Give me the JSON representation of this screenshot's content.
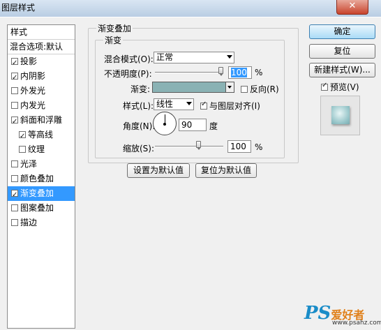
{
  "window": {
    "title": "图层样式",
    "close_symbol": "✕"
  },
  "left_panel": {
    "header": "样式",
    "items": [
      {
        "label": "混合选项:默认",
        "has_checkbox": false,
        "checked": false,
        "selected": false
      },
      {
        "label": "投影",
        "has_checkbox": true,
        "checked": true,
        "selected": false
      },
      {
        "label": "内阴影",
        "has_checkbox": true,
        "checked": true,
        "selected": false
      },
      {
        "label": "外发光",
        "has_checkbox": true,
        "checked": false,
        "selected": false
      },
      {
        "label": "内发光",
        "has_checkbox": true,
        "checked": false,
        "selected": false
      },
      {
        "label": "斜面和浮雕",
        "has_checkbox": true,
        "checked": true,
        "selected": false
      },
      {
        "label": "等高线",
        "has_checkbox": true,
        "checked": true,
        "selected": false,
        "indent": true
      },
      {
        "label": "纹理",
        "has_checkbox": true,
        "checked": false,
        "selected": false,
        "indent": true
      },
      {
        "label": "光泽",
        "has_checkbox": true,
        "checked": false,
        "selected": false
      },
      {
        "label": "颜色叠加",
        "has_checkbox": true,
        "checked": false,
        "selected": false
      },
      {
        "label": "渐变叠加",
        "has_checkbox": true,
        "checked": true,
        "selected": true
      },
      {
        "label": "图案叠加",
        "has_checkbox": true,
        "checked": false,
        "selected": false
      },
      {
        "label": "描边",
        "has_checkbox": true,
        "checked": false,
        "selected": false
      }
    ]
  },
  "panel": {
    "outer_legend": "渐变叠加",
    "inner_legend": "渐变",
    "blend_mode": {
      "label": "混合模式(O):",
      "value": "正常"
    },
    "opacity": {
      "label": "不透明度(P):",
      "value": "100",
      "unit": "%",
      "level_percent": 100
    },
    "gradient": {
      "label": "渐变:",
      "color": "#8ab2b4"
    },
    "reverse": {
      "label": "反向(R)",
      "checked": false
    },
    "style": {
      "label": "样式(L):",
      "value": "线性"
    },
    "align": {
      "label": "与图层对齐(I)",
      "checked": true
    },
    "angle": {
      "label": "角度(N):",
      "value": "90",
      "unit": "度"
    },
    "scale": {
      "label": "缩放(S):",
      "value": "100",
      "unit": "%",
      "level_percent": 100
    },
    "make_default": "设置为默认值",
    "reset_default": "复位为默认值"
  },
  "right": {
    "ok": "确定",
    "reset": "复位",
    "new_style": "新建样式(W)...",
    "preview": {
      "label": "预览(V)",
      "checked": true
    }
  },
  "watermark": {
    "ps": "PS",
    "rest": "爱好者",
    "url": "www.psahz.com"
  }
}
